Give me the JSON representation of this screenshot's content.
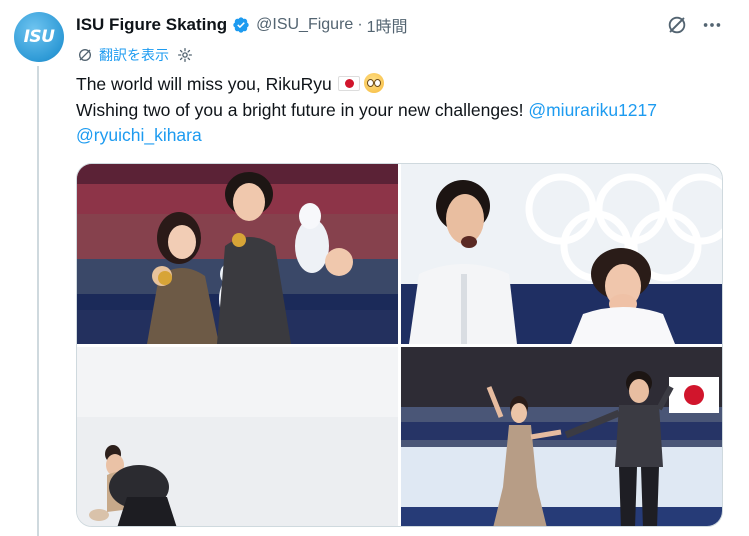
{
  "tweet": {
    "avatar_text": "ISU",
    "display_name": "ISU Figure Skating",
    "handle": "@ISU_Figure",
    "separator": "·",
    "time": "1時間",
    "translate_label": "翻訳を表示",
    "text_line1": "The world will miss you, RikuRyu",
    "text_line2": "Wishing two of you a bright future in your new challenges!",
    "mention1": "@miurariku1217",
    "mention2": "@ryuichi_kihara"
  },
  "colors": {
    "link": "#1d9bf0",
    "verified": "#1d9bf0",
    "secondary_text": "#536471",
    "thread_line": "#cfd9de"
  },
  "icons": [
    "grok-icon",
    "more-icon",
    "translate-icon",
    "settings-icon",
    "verified-icon"
  ],
  "media": {
    "photo_count": 4
  }
}
